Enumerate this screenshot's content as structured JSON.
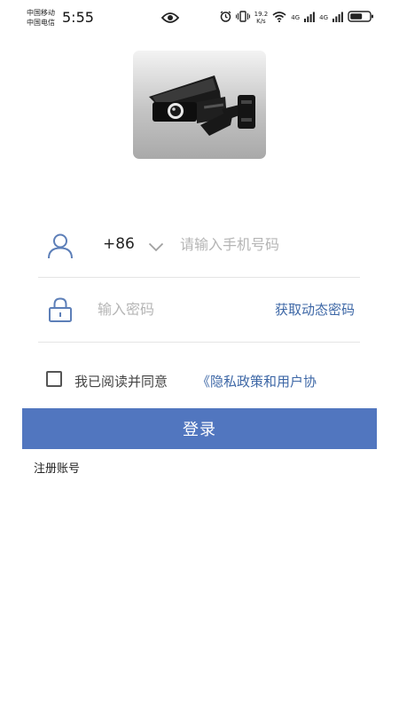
{
  "status_bar": {
    "carrier_1": "中国移动",
    "carrier_2": "中国电信",
    "time": "5:55",
    "net_speed_value": "19.2",
    "net_speed_unit": "K/s",
    "network_1": "4G",
    "network_2": "4G",
    "icons": [
      "eye-icon",
      "alarm-icon",
      "vibrate-icon",
      "wifi-icon",
      "signal-icon",
      "battery-icon"
    ]
  },
  "logo": {
    "icon": "security-camera-icon"
  },
  "login_form": {
    "country_code": "+86",
    "phone_placeholder": "请输入手机号码",
    "password_placeholder": "输入密码",
    "get_code_label": "获取动态密码",
    "agree_text": "我已阅读并同意",
    "agree_link": "《隐私政策和用户协",
    "login_button": "登录",
    "register_link": "注册账号"
  },
  "colors": {
    "accent": "#5176bf",
    "link": "#3d67a6"
  }
}
